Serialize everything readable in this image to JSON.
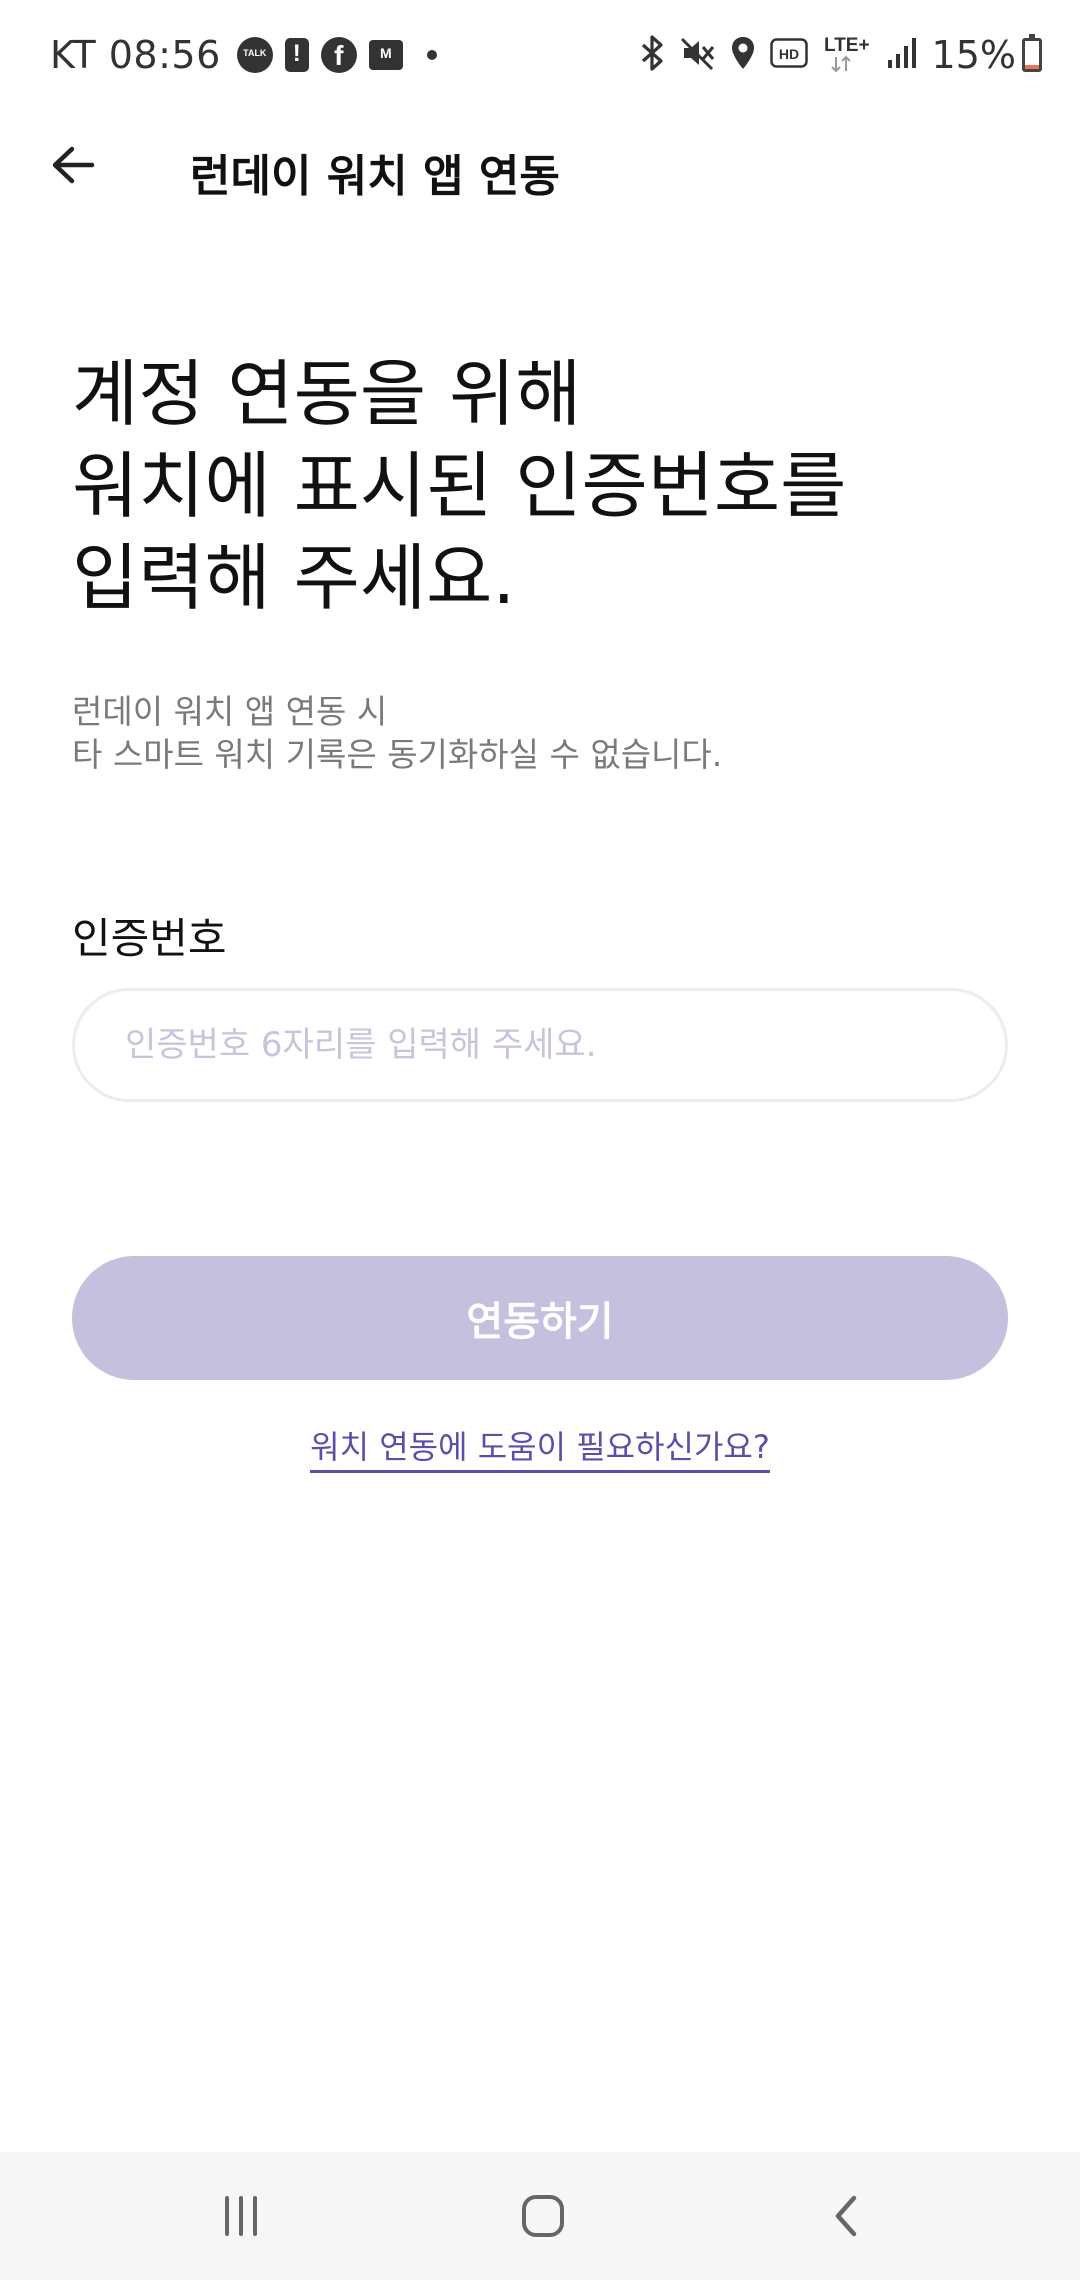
{
  "status_bar": {
    "carrier_time": "KT 08:56",
    "talk_icon_text": "TALK",
    "battery_percent": "15%",
    "battery_level": 0.15,
    "network_label": "LTE+",
    "hd_label": "HD"
  },
  "header": {
    "title": "런데이 워치 앱 연동"
  },
  "main": {
    "headline": [
      "계정 연동을 위해",
      "워치에 표시된 인증번호를",
      "입력해 주세요."
    ],
    "description": [
      "런데이 워치 앱 연동 시",
      "타 스마트 워치 기록은 동기화하실 수 없습니다."
    ],
    "field_label": "인증번호",
    "input_placeholder": "인증번호 6자리를 입력해 주세요.",
    "input_value": "",
    "submit_label": "연동하기",
    "help_link": "워치 연동에 도움이 필요하신가요?"
  },
  "colors": {
    "accent": "#5c4fa8",
    "button_disabled": "#c4c0dd",
    "placeholder": "#c8c4dc"
  }
}
